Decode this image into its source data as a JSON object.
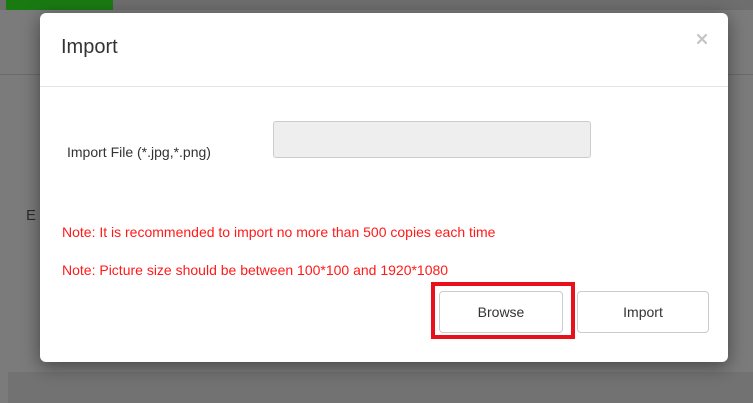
{
  "background": {
    "partial_letter": "E"
  },
  "dialog": {
    "title": "Import",
    "close_glyph": "×",
    "close_icon": "close-icon",
    "field_label": "Import File (*.jpg,*.png)",
    "file_value": "",
    "file_placeholder": "",
    "note_1": "Note: It is recommended to import no more than 500 copies each time",
    "note_2": "Note: Picture size should be between 100*100 and 1920*1080",
    "browse_label": "Browse",
    "import_label": "Import",
    "highlighted_control": "Browse"
  },
  "colors": {
    "note": "#ff1a1a",
    "highlight_border": "#e8101a",
    "brand_green": "#1a7a12",
    "overlay": "#7b7b7b"
  }
}
